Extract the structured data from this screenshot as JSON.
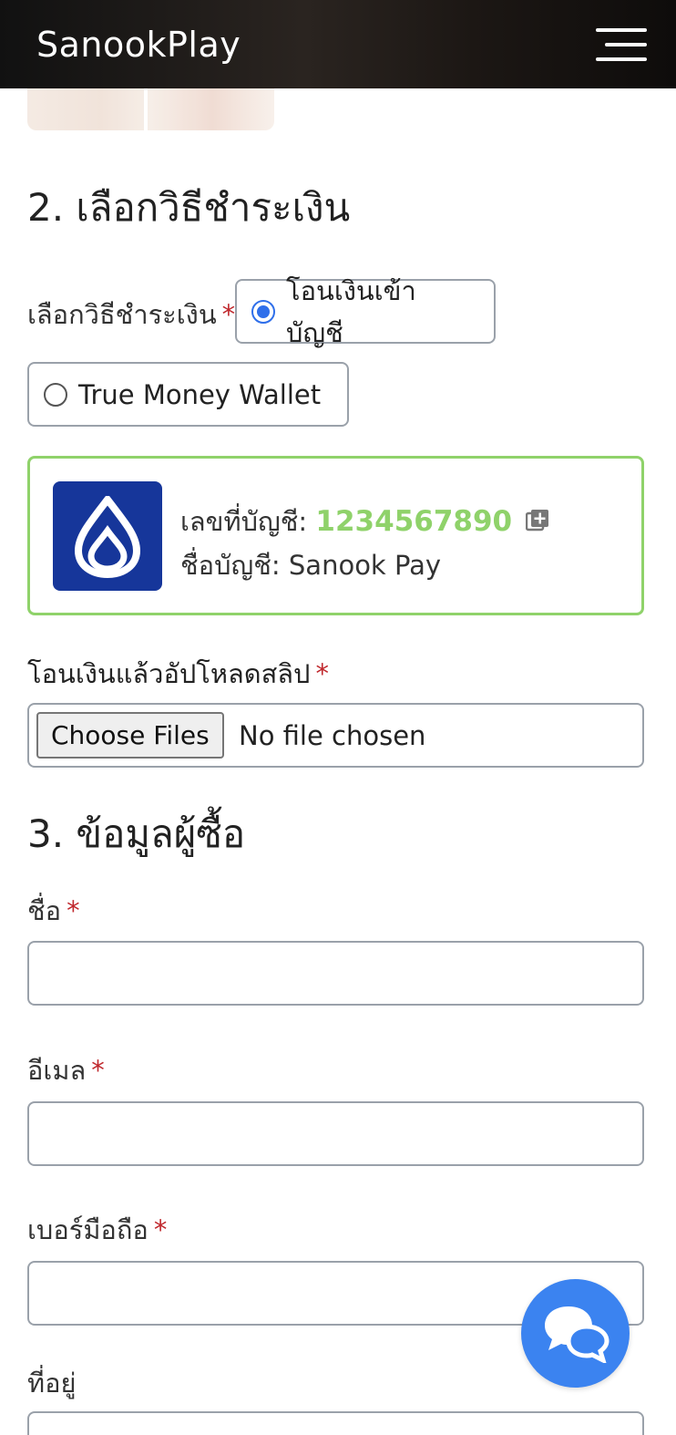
{
  "header": {
    "brand": "SanookPlay",
    "menu_icon": "hamburger-menu-icon"
  },
  "payment": {
    "section_title": "2. เลือกวิธีชำระเงิน",
    "method_label": "เลือกวิธีชำระเงิน",
    "required_mark": "*",
    "options": [
      {
        "label": "โอนเงินเข้าบัญชี",
        "selected": true
      },
      {
        "label": "True Money Wallet",
        "selected": false
      }
    ],
    "bank": {
      "logo_icon": "bank-lotus-logo-icon",
      "logo_color": "#16369a",
      "account_number_label": "เลขที่บัญชี:",
      "account_number": "1234567890",
      "account_number_color": "#8fd26a",
      "copy_icon": "copy-icon",
      "account_name_label": "ชื่อบัญชี:",
      "account_name": "Sanook Pay"
    },
    "upload_label": "โอนเงินแล้วอัปโหลดสลิป",
    "upload_button": "Choose Files",
    "upload_status": "No file chosen"
  },
  "buyer": {
    "section_title": "3. ข้อมูลผู้ซื้อ",
    "fields": [
      {
        "label": "ชื่อ",
        "required": "*",
        "value": ""
      },
      {
        "label": "อีเมล",
        "required": "*",
        "value": ""
      },
      {
        "label": "เบอร์มือถือ",
        "required": "*",
        "value": ""
      },
      {
        "label": "ที่อยู่",
        "required": "",
        "value": ""
      }
    ]
  },
  "chat": {
    "icon": "chat-bubbles-icon",
    "color": "#3b83f0"
  }
}
